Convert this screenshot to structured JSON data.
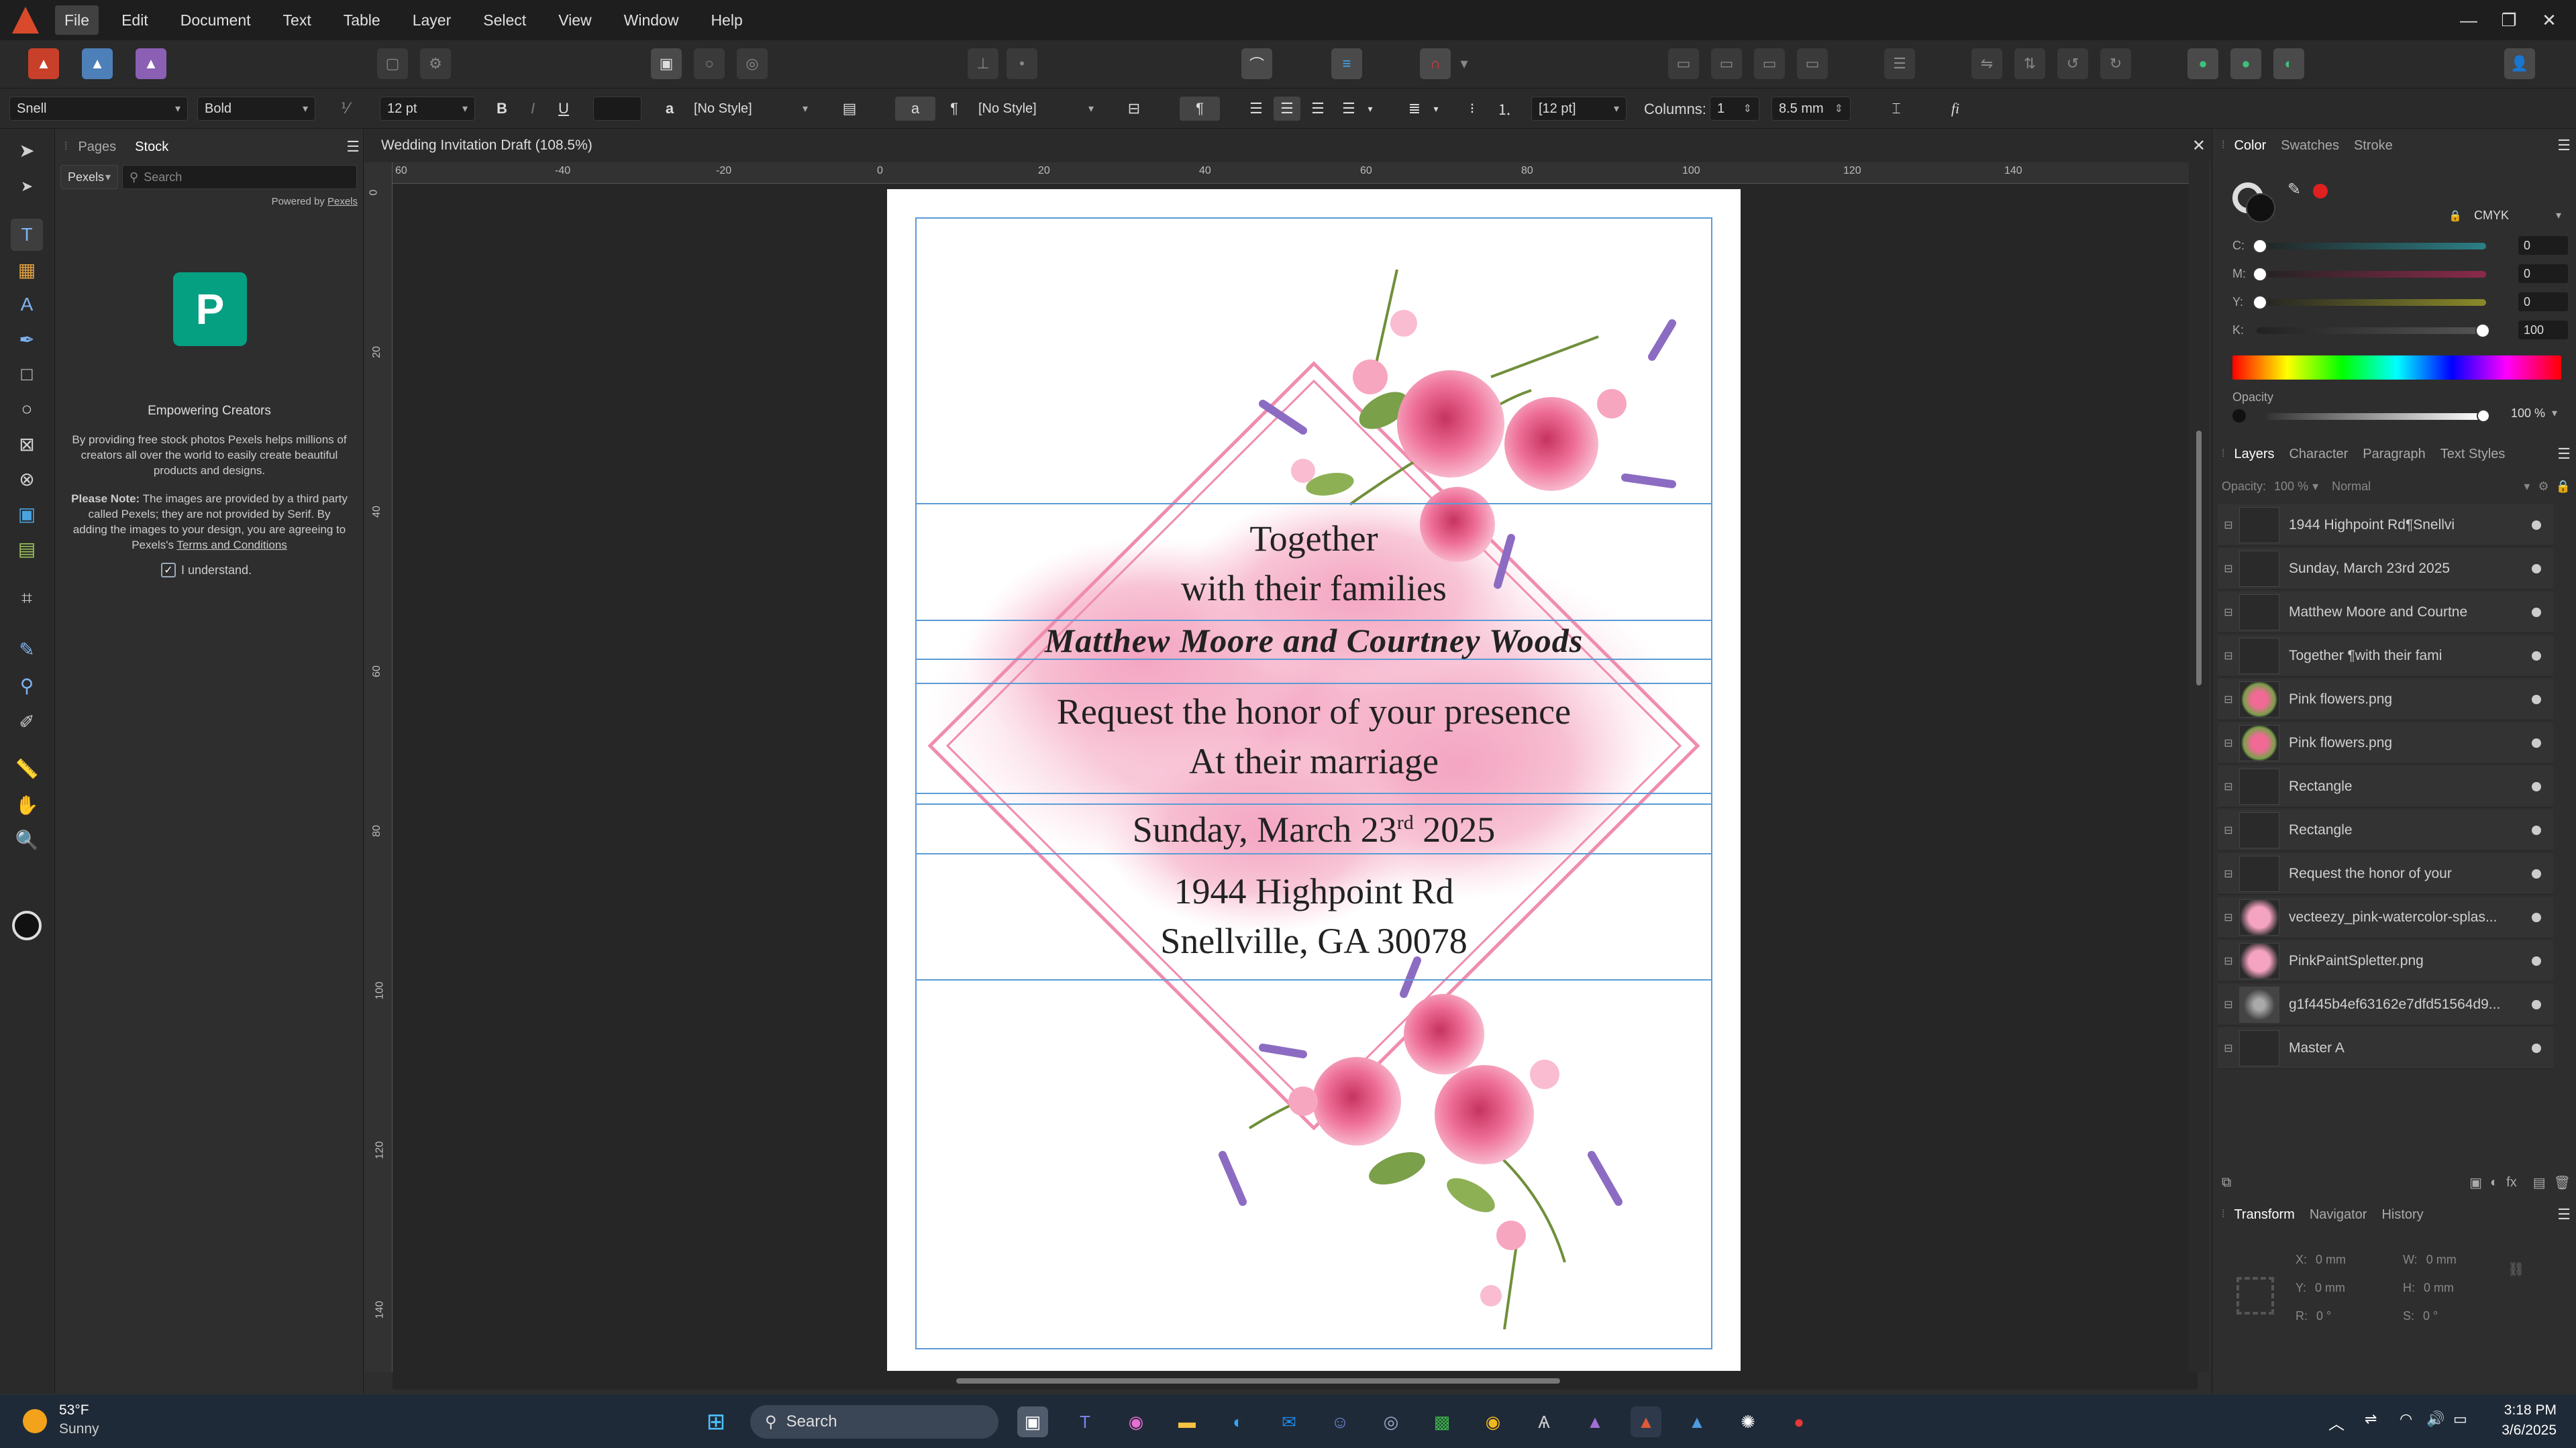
{
  "menu": {
    "items": [
      "File",
      "Edit",
      "Document",
      "Text",
      "Table",
      "Layer",
      "Select",
      "View",
      "Window",
      "Help"
    ],
    "active": "File",
    "window_controls": [
      "—",
      "❐",
      "✕"
    ]
  },
  "context_bar": {
    "font_family": "Snell",
    "font_style": "Bold",
    "font_size": "12 pt",
    "char_style": "[No Style]",
    "para_style": "[No Style]",
    "leading": "[12 pt]",
    "columns_label": "Columns:",
    "columns_value": "1",
    "gutter": "8.5 mm",
    "bold": "B",
    "italic": "I",
    "underline": "U"
  },
  "stock_panel": {
    "tabs": [
      "Pages",
      "Stock"
    ],
    "active_tab": "Stock",
    "source": "Pexels",
    "search_placeholder": "Search",
    "powered_by": "Powered by",
    "powered_link": "Pexels",
    "logo_letter": "P",
    "heading": "Empowering Creators",
    "description": "By providing free stock photos Pexels helps millions of creators all over the world to easily create beautiful products and designs.",
    "note_label": "Please Note:",
    "note_text": "The images are provided by a third party called Pexels; they are not provided by Serif. By adding the images to your design, you are agreeing to Pexels's",
    "note_link": "Terms and Conditions",
    "checkbox_label": "I understand.",
    "checkbox_checked": true
  },
  "document": {
    "tab_title": "Wedding Invitation Draft (108.5%)",
    "h_ruler": [
      "60",
      "-40",
      "-20",
      "0",
      "20",
      "40",
      "60",
      "80",
      "100",
      "120",
      "140"
    ],
    "v_ruler": [
      "0",
      "20",
      "40",
      "60",
      "80",
      "100",
      "120",
      "140"
    ],
    "lines": {
      "together": "Together",
      "families": "with their families",
      "names": "Matthew Moore and Courtney Woods",
      "request": "Request the honor of your presence",
      "marriage": "At their marriage",
      "date_pre": "Sunday, March 23",
      "date_sup": "rd",
      "date_post": " 2025",
      "address1": "1944 Highpoint Rd",
      "address2": "Snellville, GA 30078"
    },
    "accent_pink": "#f08caf",
    "frame_blue": "#5b9bd5"
  },
  "color_panel": {
    "tabs": [
      "Color",
      "Swatches",
      "Stroke"
    ],
    "active_tab": "Color",
    "model": "CMYK",
    "channels": [
      {
        "label": "C:",
        "value": "0",
        "fraction": 0
      },
      {
        "label": "M:",
        "value": "0",
        "fraction": 0
      },
      {
        "label": "Y:",
        "value": "0",
        "fraction": 0
      },
      {
        "label": "K:",
        "value": "100",
        "fraction": 1
      }
    ],
    "opacity_label": "Opacity",
    "opacity_value": "100 %"
  },
  "layers_panel": {
    "tabs": [
      "Layers",
      "Character",
      "Paragraph",
      "Text Styles"
    ],
    "active_tab": "Layers",
    "opacity_label": "Opacity:",
    "opacity_value": "100 %",
    "blend_mode": "Normal",
    "layers": [
      {
        "name": "1944 Highpoint Rd¶Snellvi",
        "thumb": "blank"
      },
      {
        "name": "Sunday, March 23rd 2025",
        "thumb": "blank"
      },
      {
        "name": "Matthew Moore and Courtne",
        "thumb": "blank"
      },
      {
        "name": "Together ¶with their fami",
        "thumb": "blank"
      },
      {
        "name": "Pink flowers.png",
        "thumb": "flower"
      },
      {
        "name": "Pink flowers.png",
        "thumb": "flower"
      },
      {
        "name": "Rectangle",
        "thumb": "blank"
      },
      {
        "name": "Rectangle",
        "thumb": "blank"
      },
      {
        "name": "Request the honor of your",
        "thumb": "blank"
      },
      {
        "name": "vecteezy_pink-watercolor-splas...",
        "thumb": "splash"
      },
      {
        "name": "PinkPaintSpletter.png",
        "thumb": "splash"
      },
      {
        "name": "g1f445b4ef63162e7dfd51564d9...",
        "thumb": "photo"
      },
      {
        "name": "Master A",
        "thumb": "blank"
      }
    ]
  },
  "transform_panel": {
    "tabs": [
      "Transform",
      "Navigator",
      "History"
    ],
    "active_tab": "Transform",
    "fields": [
      {
        "label": "X:",
        "value": "0 mm"
      },
      {
        "label": "W:",
        "value": "0 mm"
      },
      {
        "label": "Y:",
        "value": "0 mm"
      },
      {
        "label": "H:",
        "value": "0 mm"
      },
      {
        "label": "R:",
        "value": "0 °"
      },
      {
        "label": "S:",
        "value": "0 °"
      }
    ]
  },
  "taskbar": {
    "weather_temp": "53°F",
    "weather_desc": "Sunny",
    "search_label": "Search",
    "time": "3:18 PM",
    "date": "3/6/2025"
  }
}
